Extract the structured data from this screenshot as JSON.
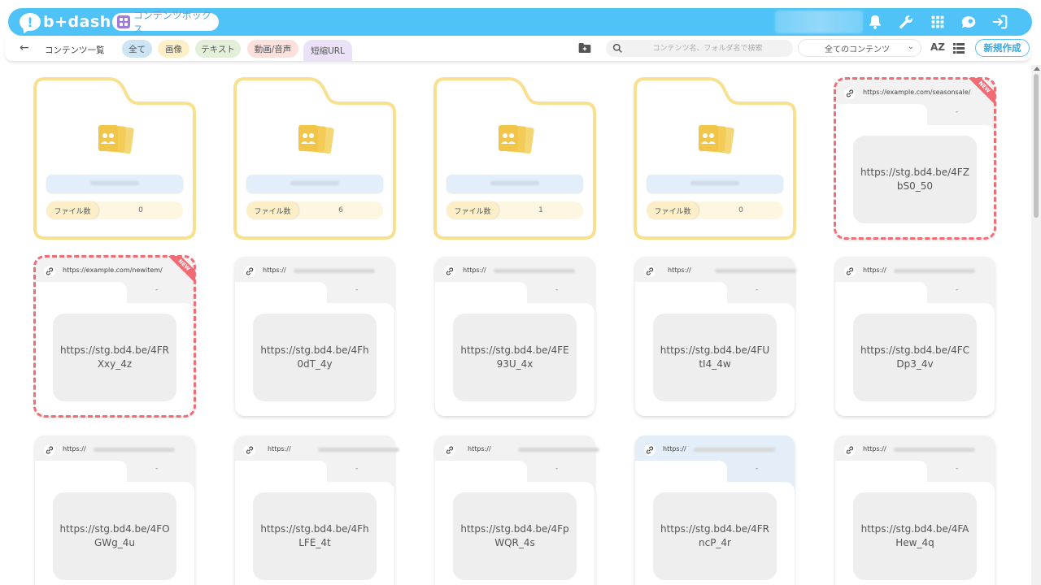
{
  "header": {
    "logo_mark": "!",
    "logo_text": "b+dash",
    "content_box_label": "コンテンツボックス"
  },
  "toolbar": {
    "back_icon": "back-arrow-icon",
    "title": "コンテンツ一覧",
    "filters": [
      {
        "label": "全て",
        "color": "#cde4f5"
      },
      {
        "label": "画像",
        "color": "#fdf0c9"
      },
      {
        "label": "テキスト",
        "color": "#e3efd9"
      },
      {
        "label": "動画/音声",
        "color": "#fbe0dc"
      },
      {
        "label": "短縮URL",
        "color": "#ece2f8"
      }
    ],
    "search_placeholder": "コンテンツ名、フォルダ名で検索",
    "select_value": "全てのコンテンツ",
    "sort_label": "AZ",
    "new_button": "新規作成"
  },
  "folders": [
    {
      "count_label": "ファイル数",
      "count": "0"
    },
    {
      "count_label": "ファイル数",
      "count": "6"
    },
    {
      "count_label": "ファイル数",
      "count": "1"
    },
    {
      "count_label": "ファイル数",
      "count": "0"
    }
  ],
  "url_cards": [
    {
      "source": "https://example.com/seasonsale/",
      "dash": "-",
      "short_url": "https://stg.bd4.be/4FZbS0_50",
      "is_new": true,
      "new_label": "NEW"
    },
    {
      "source": "https://example.com/newitem/",
      "dash": "-",
      "short_url": "https://stg.bd4.be/4FRXxy_4z",
      "is_new": true,
      "new_label": "NEW"
    },
    {
      "source": "https://",
      "dash": "-",
      "short_url": "https://stg.bd4.be/4Fh0dT_4y",
      "is_new": false
    },
    {
      "source": "https://",
      "dash": "-",
      "short_url": "https://stg.bd4.be/4FE93U_4x",
      "is_new": false
    },
    {
      "source": "https://",
      "dash": "-",
      "short_url": "https://stg.bd4.be/4FUtI4_4w",
      "is_new": false
    },
    {
      "source": "https://",
      "dash": "-",
      "short_url": "https://stg.bd4.be/4FCDp3_4v",
      "is_new": false
    },
    {
      "source": "https://",
      "dash": "-",
      "short_url": "https://stg.bd4.be/4FOGWg_4u",
      "is_new": false
    },
    {
      "source": "https://",
      "dash": "-",
      "short_url": "https://stg.bd4.be/4FhLFE_4t",
      "is_new": false
    },
    {
      "source": "https://",
      "dash": "-",
      "short_url": "https://stg.bd4.be/4FpWQR_4s",
      "is_new": false
    },
    {
      "source": "https://",
      "dash": "-",
      "short_url": "https://stg.bd4.be/4FRncP_4r",
      "is_new": false,
      "highlighted": true
    },
    {
      "source": "https://",
      "dash": "-",
      "short_url": "https://stg.bd4.be/4FAHew_4q",
      "is_new": false
    }
  ],
  "colors": {
    "brand": "#4fc3f7",
    "folder_outline": "#f7e08f",
    "new_accent": "#ef6e76"
  }
}
